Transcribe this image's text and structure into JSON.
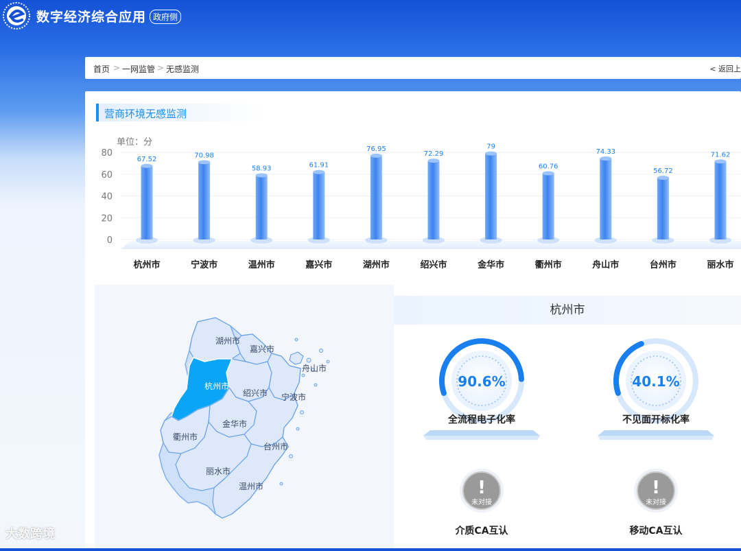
{
  "header": {
    "app_title": "数字经济综合应用",
    "side_badge": "政府侧"
  },
  "breadcrumb": {
    "items": [
      "首页",
      "一网监管",
      "无感监测"
    ],
    "separator": ">",
    "back_label": "< 返回上"
  },
  "section": {
    "title": "营商环境无感监测"
  },
  "chart_data": {
    "type": "bar",
    "unit_label": "单位：分",
    "categories": [
      "杭州市",
      "宁波市",
      "温州市",
      "嘉兴市",
      "湖州市",
      "绍兴市",
      "金华市",
      "衢州市",
      "舟山市",
      "台州市",
      "丽水市"
    ],
    "values": [
      67.52,
      70.98,
      58.93,
      61.91,
      76.95,
      72.29,
      79,
      60.76,
      74.33,
      56.72,
      71.62
    ],
    "value_labels": [
      "67.52",
      "70.98",
      "58.93",
      "61.91",
      "76.95",
      "72.29",
      "79",
      "60.76",
      "74.33",
      "56.72",
      "71.62"
    ],
    "yticks": [
      0,
      20,
      40,
      60,
      80
    ],
    "ylim": [
      0,
      80
    ],
    "bar_color": "#4d8ff2"
  },
  "map": {
    "selected": "杭州市",
    "cities": [
      "湖州市",
      "嘉兴市",
      "舟山市",
      "杭州市",
      "绍兴市",
      "宁波市",
      "金华市",
      "衢州市",
      "台州市",
      "丽水市",
      "温州市"
    ],
    "selected_color": "#0aa5f5",
    "region_color": "#dde9fb"
  },
  "detail": {
    "city": "杭州市",
    "gauges": [
      {
        "value": "90.6%",
        "label": "全流程电子化率",
        "fraction": 0.906
      },
      {
        "value": "40.1%",
        "label": "不见面开标化率",
        "fraction": 0.401
      }
    ],
    "ca": [
      {
        "label": "介质CA互认",
        "status": "未对接",
        "icon": "exclamation-icon"
      },
      {
        "label": "移动CA互认",
        "status": "未对接",
        "icon": "exclamation-icon"
      }
    ]
  },
  "watermark": "大数跨境"
}
